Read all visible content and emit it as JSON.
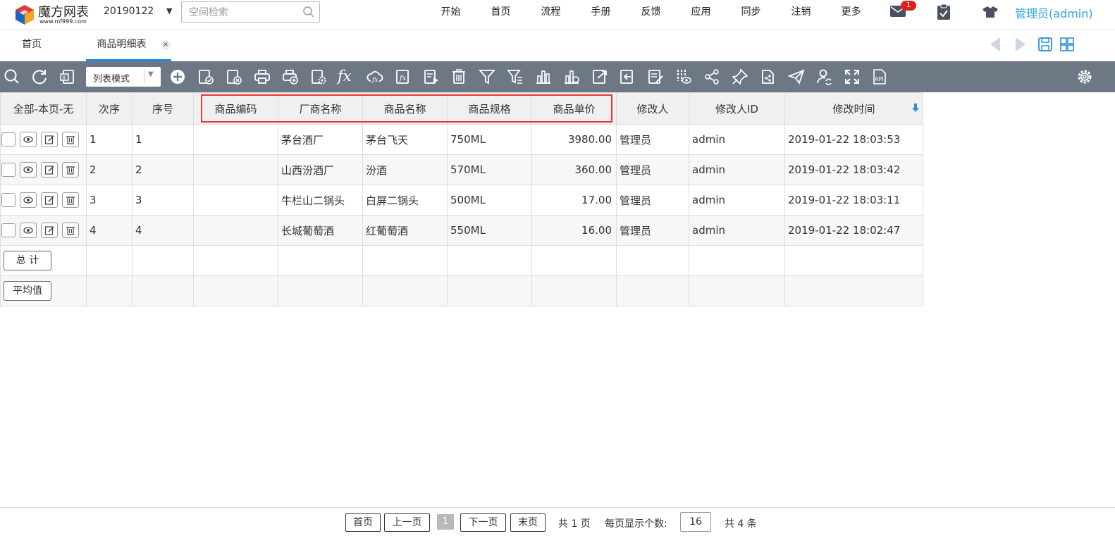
{
  "app": {
    "logo_title": "魔方网表",
    "logo_url": "www.mf999.com",
    "space_value": "20190122",
    "search_placeholder": "空间检索",
    "nav": [
      "开始",
      "首页",
      "流程",
      "手册",
      "反馈",
      "应用",
      "同步",
      "注销",
      "更多"
    ],
    "mail_badge": "1",
    "user": "管理员(admin)",
    "accent": "#2aa7dd"
  },
  "tabs": {
    "home": "首页",
    "active": "商品明细表",
    "close_glyph": "×"
  },
  "toolbar": {
    "mode_label": "列表模式",
    "fx_label": "fx",
    "icons": [
      "search-icon",
      "refresh-icon",
      "excel-icon",
      "add-icon",
      "check-doc-icon",
      "cancel-doc-icon",
      "print-icon",
      "print-add-icon",
      "print-settings-icon",
      "formula-icon",
      "cloud-sync-icon",
      "formula-doc-icon",
      "play-doc-icon",
      "delete-icon",
      "filter-icon",
      "advanced-filter-icon",
      "bar-chart-icon",
      "chart-settings-icon",
      "export-icon",
      "import-icon",
      "edit-doc-icon",
      "column-view-icon",
      "share-icon",
      "pin-icon",
      "file-share-icon",
      "send-icon",
      "user-sync-icon",
      "fullscreen-icon",
      "api-icon",
      "settings-icon"
    ],
    "bg": "#6e7784"
  },
  "table": {
    "columns": [
      "全部-本页-无",
      "次序",
      "序号",
      "商品编码",
      "厂商名称",
      "商品名称",
      "商品规格",
      "商品单价",
      "修改人",
      "修改人ID",
      "修改时间"
    ],
    "rows": [
      [
        "1",
        "1",
        "",
        "茅台酒厂",
        "茅台飞天",
        "750ML",
        "3980.00",
        "管理员",
        "admin",
        "2019-01-22 18:03:53"
      ],
      [
        "2",
        "2",
        "",
        "山西汾酒厂",
        "汾酒",
        "570ML",
        "360.00",
        "管理员",
        "admin",
        "2019-01-22 18:03:42"
      ],
      [
        "3",
        "3",
        "",
        "牛栏山二锅头",
        "白屏二锅头",
        "500ML",
        "17.00",
        "管理员",
        "admin",
        "2019-01-22 18:03:11"
      ],
      [
        "4",
        "4",
        "",
        "长城葡萄酒",
        "红葡萄酒",
        "550ML",
        "16.00",
        "管理员",
        "admin",
        "2019-01-22 18:02:47"
      ]
    ],
    "total_label": "总 计",
    "avg_label": "平均值",
    "highlight_color": "#e53935"
  },
  "pager": {
    "first": "首页",
    "prev": "上一页",
    "current": "1",
    "next": "下一页",
    "last": "末页",
    "total_pages": "共 1 页",
    "per_page_label": "每页显示个数:",
    "per_page_value": "16",
    "total_items": "共 4 条"
  }
}
